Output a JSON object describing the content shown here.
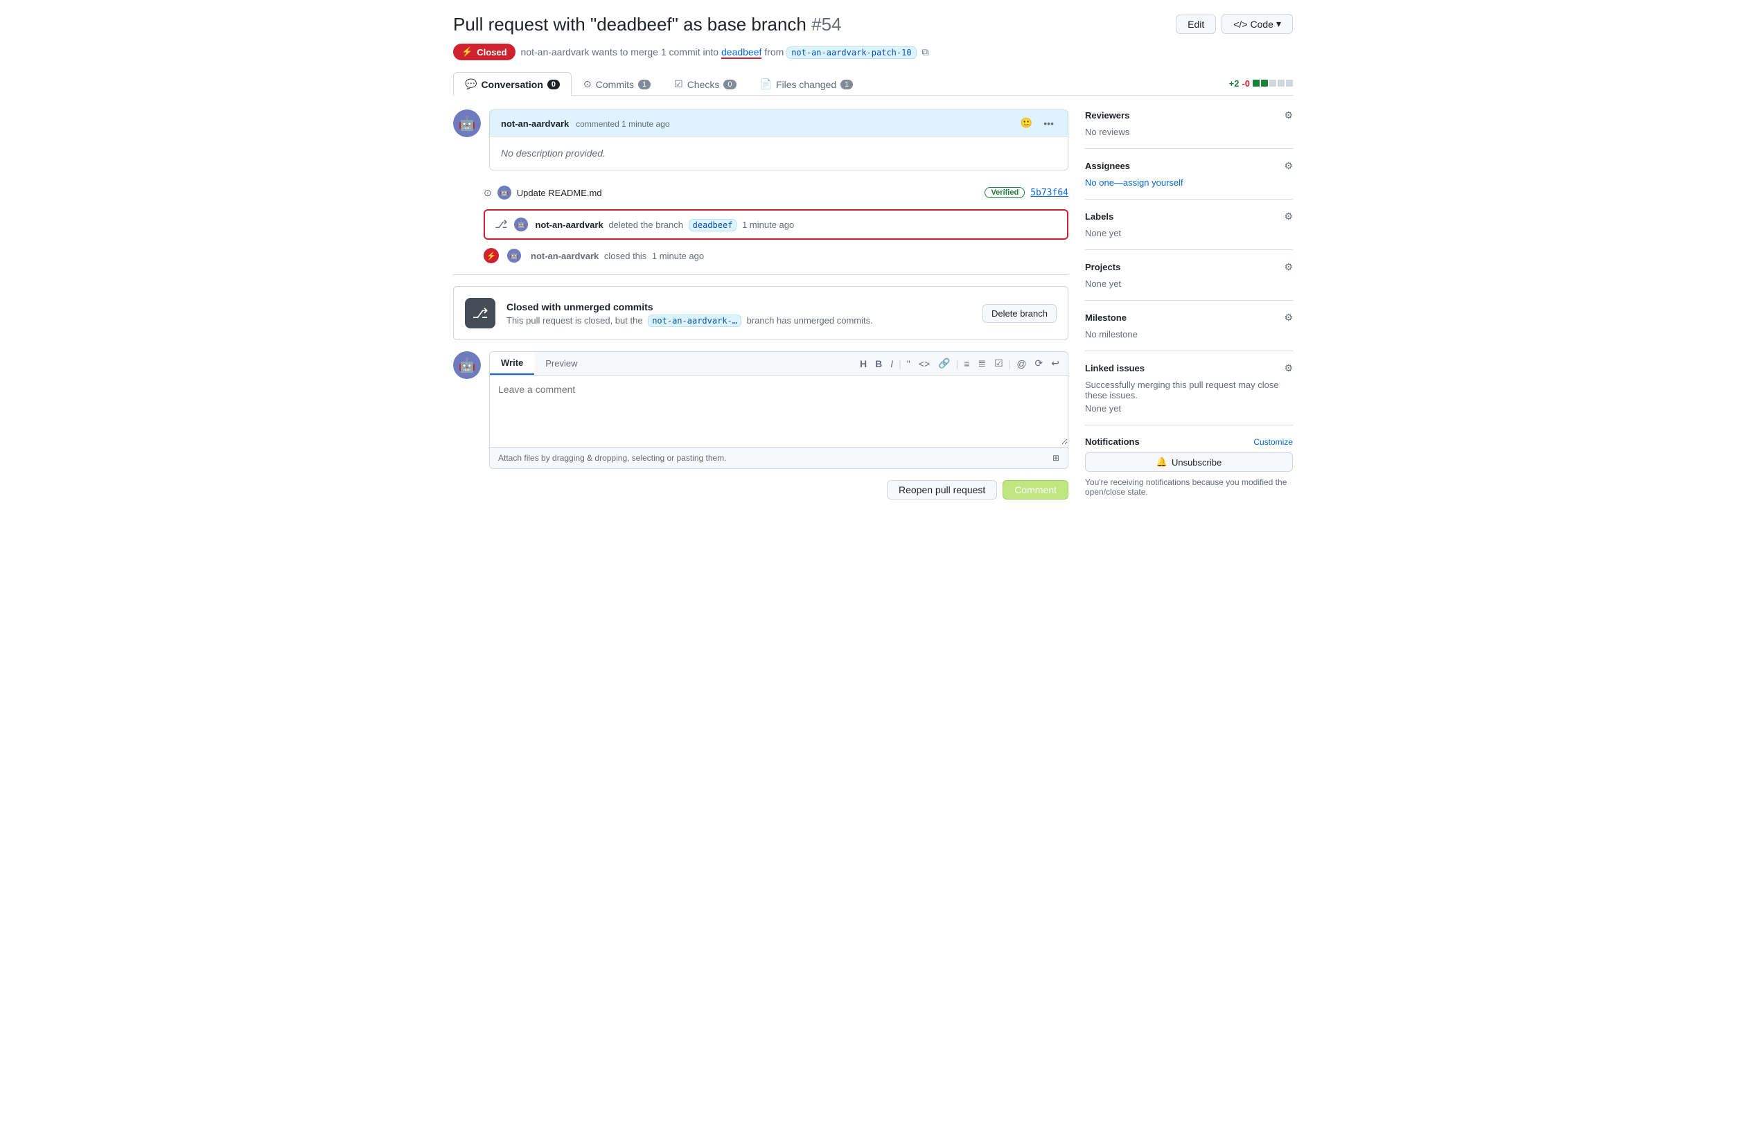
{
  "page": {
    "title": "Pull request with \"deadbeef\" as base branch",
    "pr_number": "#54",
    "header_buttons": {
      "edit": "Edit",
      "code": "Code"
    }
  },
  "status": {
    "badge": "Closed",
    "description": "not-an-aardvark wants to merge 1 commit into",
    "base_branch": "deadbeef",
    "from_text": "from",
    "head_branch": "not-an-aardvark-patch-10"
  },
  "tabs": {
    "conversation": {
      "label": "Conversation",
      "count": "0"
    },
    "commits": {
      "label": "Commits",
      "count": "1"
    },
    "checks": {
      "label": "Checks",
      "count": "0"
    },
    "files_changed": {
      "label": "Files changed",
      "count": "1"
    }
  },
  "diff_stat": {
    "additions": "+2",
    "deletions": "-0",
    "blocks": [
      "green",
      "green",
      "empty",
      "empty",
      "empty"
    ]
  },
  "comment": {
    "author": "not-an-aardvark",
    "time": "commented 1 minute ago",
    "body": "No description provided."
  },
  "commit": {
    "message": "Update README.md",
    "badge": "Verified",
    "hash": "5b73f64"
  },
  "deleted_branch_event": {
    "author": "not-an-aardvark",
    "action": "deleted the branch",
    "branch": "deadbeef",
    "time": "1 minute ago"
  },
  "closed_event": {
    "author": "not-an-aardvark",
    "action": "closed this",
    "time": "1 minute ago"
  },
  "warning_box": {
    "title": "Closed with unmerged commits",
    "description": "This pull request is closed, but the",
    "branch": "not-an-aardvark-…",
    "description2": "branch has unmerged commits.",
    "button": "Delete branch"
  },
  "editor": {
    "tab_write": "Write",
    "tab_preview": "Preview",
    "placeholder": "Leave a comment",
    "footer_text": "Attach files by dragging & dropping, selecting or pasting them.",
    "toolbar": {
      "heading": "H",
      "bold": "B",
      "italic": "I",
      "quote": "\"",
      "code": "<>",
      "link": "🔗",
      "list_ul": "≡",
      "list_ol": "≣",
      "checklist": "☑",
      "mention": "@",
      "ref": "⟳",
      "undo": "↩"
    }
  },
  "submit": {
    "reopen": "Reopen pull request",
    "comment": "Comment"
  },
  "sidebar": {
    "reviewers": {
      "title": "Reviewers",
      "value": "No reviews"
    },
    "assignees": {
      "title": "Assignees",
      "value": "No one—assign yourself"
    },
    "labels": {
      "title": "Labels",
      "value": "None yet"
    },
    "projects": {
      "title": "Projects",
      "value": "None yet"
    },
    "milestone": {
      "title": "Milestone",
      "value": "No milestone"
    },
    "linked_issues": {
      "title": "Linked issues",
      "description": "Successfully merging this pull request may close these issues.",
      "value": "None yet"
    },
    "notifications": {
      "title": "Notifications",
      "customize": "Customize",
      "unsubscribe": "Unsubscribe",
      "description": "You're receiving notifications because you modified the open/close state."
    }
  }
}
